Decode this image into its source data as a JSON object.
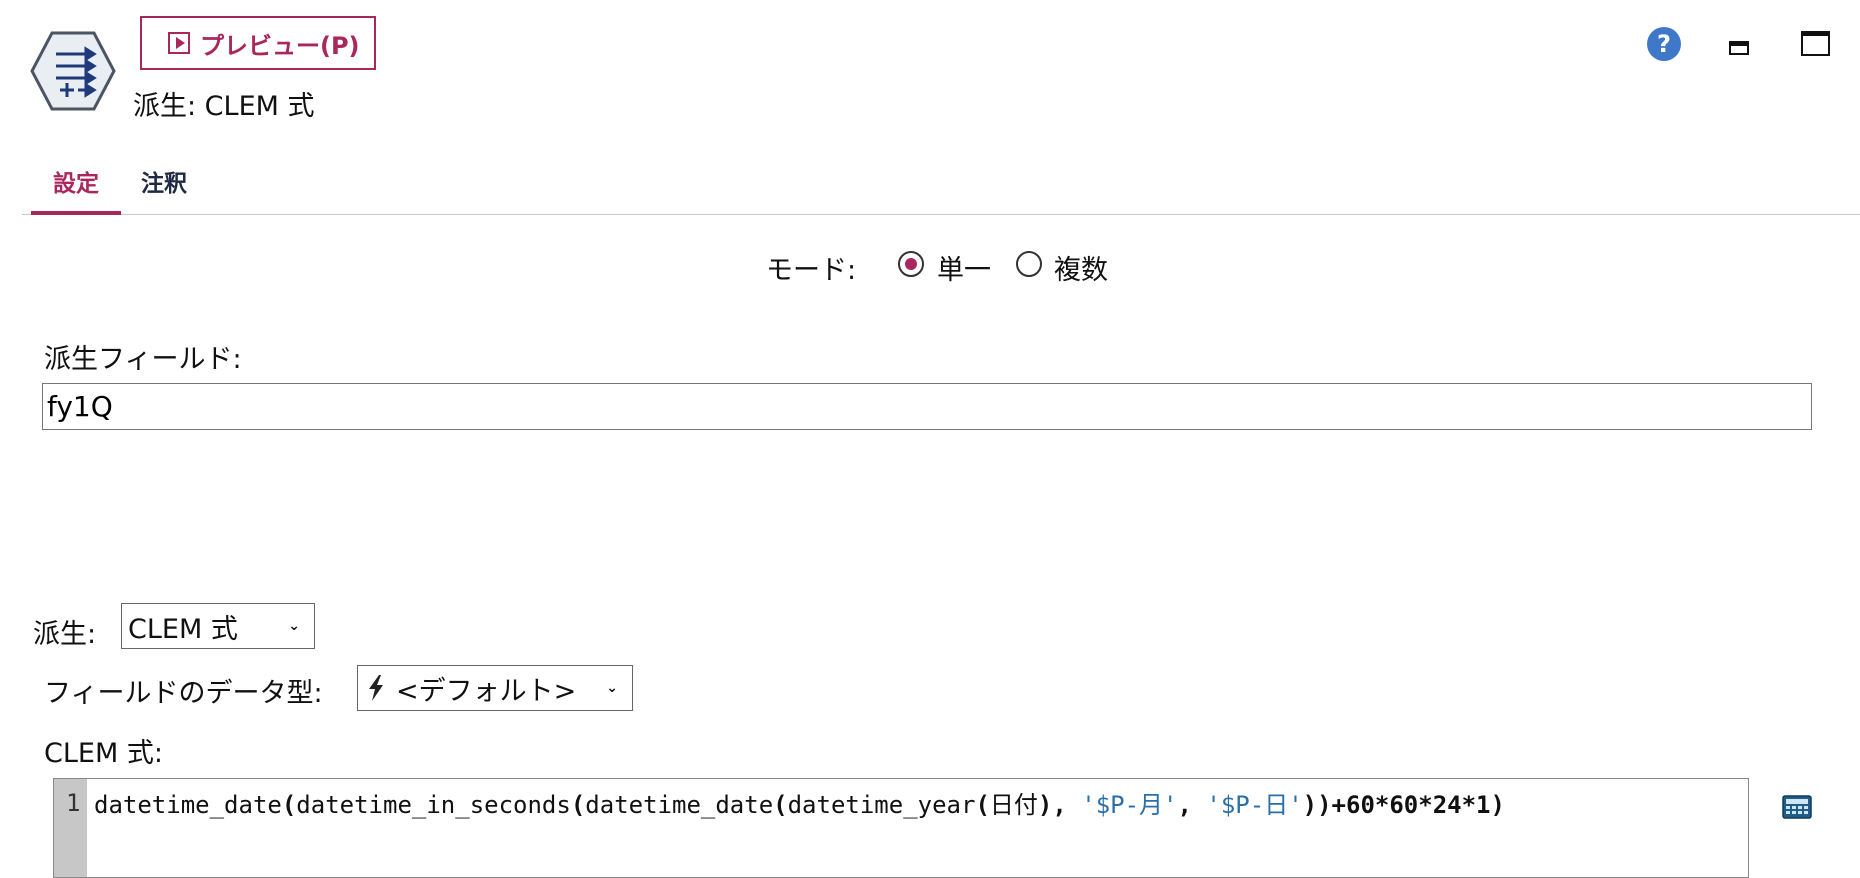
{
  "header": {
    "preview_label": "プレビュー(P)",
    "node_title": "派生: CLEM 式",
    "node_icon": "derive-node-icon",
    "help_icon": "help-icon",
    "minimize_icon": "minimize-icon",
    "maximize_icon": "maximize-icon"
  },
  "tabs": [
    {
      "label": "設定",
      "active": true
    },
    {
      "label": "注釈",
      "active": false
    }
  ],
  "mode": {
    "label": "モード:",
    "options": [
      {
        "label": "単一",
        "selected": true
      },
      {
        "label": "複数",
        "selected": false
      }
    ]
  },
  "derive_field": {
    "label": "派生フィールド:",
    "value": "fy1Q"
  },
  "derive_as": {
    "label": "派生:",
    "value": "CLEM 式"
  },
  "field_type": {
    "label": "フィールドのデータ型:",
    "value": "<デフォルト>",
    "icon": "lightning-icon"
  },
  "clem": {
    "label": "CLEM 式:",
    "line_number": "1",
    "parts": [
      "datetime_date",
      "(",
      "datetime_in_seconds",
      "(",
      "datetime_date",
      "(",
      "datetime_year",
      "(",
      "日付",
      "), ",
      "'$P-月'",
      ", ",
      "'$P-日'",
      "))+60*60*24*1)"
    ],
    "calculator_icon": "expression-builder-icon"
  },
  "colors": {
    "accent": "#a8285e",
    "help_blue": "#3f78c8",
    "string_blue": "#2a6fa8"
  }
}
